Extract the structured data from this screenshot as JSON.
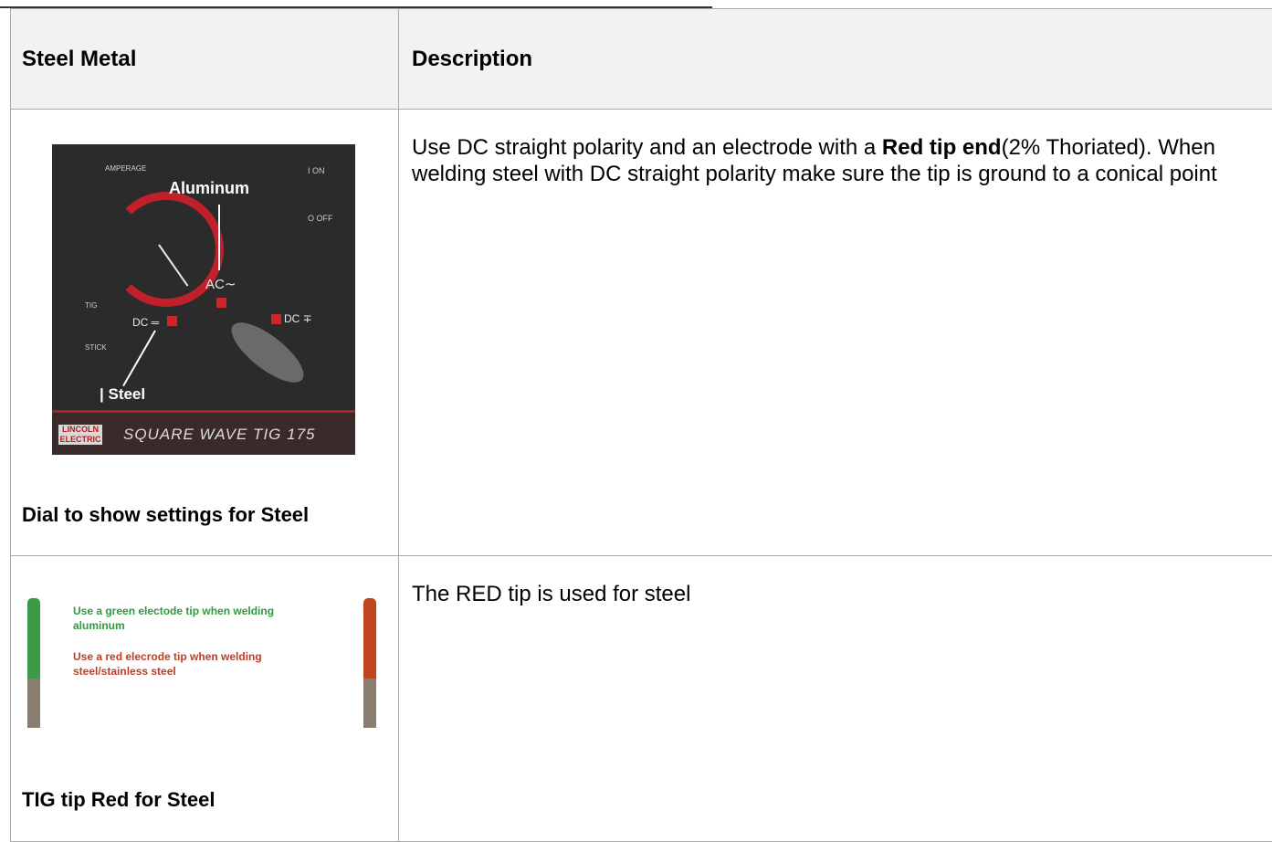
{
  "table": {
    "header": {
      "col1": "Steel Metal",
      "col2": "Description"
    },
    "rows": [
      {
        "image": {
          "labels": {
            "amperage": "AMPERAGE",
            "aluminum": "Aluminum",
            "ac": "AC∼",
            "tig": "TIG",
            "stick": "STICK",
            "dc_left": "DC ═",
            "dc_right": "DC ∓",
            "steel": "| Steel",
            "on": "I ON",
            "off": "O OFF"
          },
          "logo": "LINCOLN ELECTRIC",
          "model": "SQUARE WAVE TIG 175"
        },
        "caption": "Dial to show settings for Steel",
        "description": {
          "part1": "Use DC straight polarity and an electrode with a ",
          "bold": "Red tip end",
          "part2": "(2% Thoriated). When welding steel with DC straight polarity make sure the tip is ground to a conical point"
        }
      },
      {
        "image": {
          "green_note": "Use a green electode tip when welding aluminum",
          "red_note": "Use a red elecrode tip when welding steel/stainless steel"
        },
        "caption": "TIG tip Red for Steel",
        "description": {
          "text": "The RED tip is used for steel"
        }
      }
    ]
  },
  "colors": {
    "red_tip": "#c0441f",
    "green_tip": "#3b9a45",
    "panel_red": "#d0242c"
  }
}
